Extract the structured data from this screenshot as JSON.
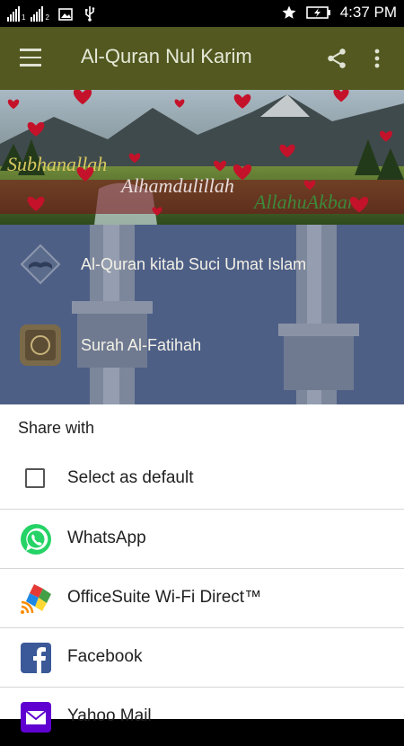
{
  "status_bar": {
    "sim1": "1",
    "sim2": "2",
    "time": "4:37 PM",
    "icons": [
      "signal-icon",
      "image-icon",
      "usb-icon",
      "star-icon",
      "battery-charging-icon"
    ]
  },
  "app_bar": {
    "title": "Al-Quran Nul Karim",
    "background": "#52581f",
    "icons": [
      "menu-icon",
      "share-icon",
      "more-vert-icon"
    ]
  },
  "banner": {
    "words": [
      "Subhanallah",
      "Alhamdulillah",
      "AllahuAkbar"
    ]
  },
  "list": {
    "items": [
      {
        "label": "Al-Quran kitab Suci Umat Islam",
        "icon": "quran-book-icon"
      },
      {
        "label": "Surah Al-Fatihah",
        "icon": "quran-cover-icon"
      }
    ]
  },
  "share_sheet": {
    "title": "Share with",
    "default_label": "Select as default",
    "apps": [
      {
        "label": "WhatsApp",
        "icon": "whatsapp-icon",
        "color": "#25d366"
      },
      {
        "label": "OfficeSuite Wi-Fi Direct™",
        "icon": "officesuite-icon",
        "color": "#e53935"
      },
      {
        "label": "Facebook",
        "icon": "facebook-icon",
        "color": "#3b5998"
      },
      {
        "label": "Yahoo Mail",
        "icon": "yahoo-mail-icon",
        "color": "#5f01d1"
      }
    ]
  }
}
